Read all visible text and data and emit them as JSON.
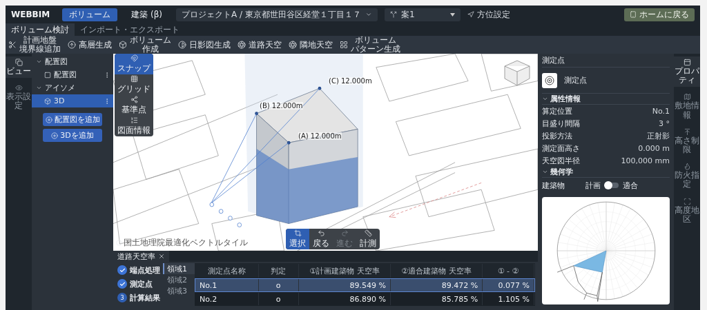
{
  "app": {
    "logo": "WEBBIM"
  },
  "mode_tabs": [
    {
      "label": "ボリューム",
      "selected": true
    },
    {
      "label": "建築 (β)",
      "selected": false
    }
  ],
  "project_select": {
    "value": "プロジェクトA / 東京都世田谷区経堂１丁目１７"
  },
  "plan_select": {
    "value": "案1"
  },
  "orientation_button": {
    "label": "方位設定"
  },
  "home_button": {
    "label": "ホームに戻る"
  },
  "sub_tabs": [
    {
      "label": "ボリューム検討",
      "selected": true
    },
    {
      "label": "インポート・エクスポート",
      "selected": false
    }
  ],
  "toolbar": [
    {
      "lines": [
        "計画地盤",
        "境界線追加"
      ]
    },
    {
      "lines": [
        "高層生成"
      ]
    },
    {
      "lines": [
        "ボリューム",
        "作成"
      ]
    },
    {
      "lines": [
        "日影図生成"
      ]
    },
    {
      "lines": [
        "道路天空"
      ]
    },
    {
      "lines": [
        "隣地天空"
      ]
    },
    {
      "lines": [
        "ボリューム",
        "パターン生成"
      ]
    }
  ],
  "left_rail": [
    {
      "label": "ビュー",
      "selected": true
    },
    {
      "label": "表示設定",
      "selected": false
    }
  ],
  "tree": [
    {
      "label": "配置図",
      "expanded": true,
      "children": [
        {
          "label": "配置図",
          "selected": false
        }
      ]
    },
    {
      "label": "アイソメ",
      "expanded": true,
      "children": [
        {
          "label": "3D",
          "selected": true
        }
      ]
    }
  ],
  "tree_buttons": [
    "配置図を追加",
    "3Dを追加"
  ],
  "canvas": {
    "side_tools": [
      {
        "label": "スナップ",
        "selected": true
      },
      {
        "label": "グリッド",
        "selected": false
      },
      {
        "label": "基準点",
        "selected": false
      },
      {
        "label": "図面情報",
        "selected": false
      }
    ],
    "bottom_tools": [
      {
        "label": "選択",
        "selected": true,
        "disabled": false
      },
      {
        "label": "戻る",
        "selected": false,
        "disabled": false
      },
      {
        "label": "進む",
        "selected": false,
        "disabled": true
      },
      {
        "label": "計測",
        "selected": false,
        "disabled": false
      }
    ],
    "height_labels": [
      "(C) 12.000m",
      "(B) 12.000m",
      "(A) 12.000m"
    ],
    "attribution": "国土地理院最適化ベクトルタイル"
  },
  "properties": {
    "title": "測定点",
    "object_name": "測定点",
    "sections": [
      {
        "title": "属性情報",
        "expanded": true,
        "rows": [
          {
            "kind": "value",
            "label": "算定位置",
            "value": "No.1"
          },
          {
            "kind": "value",
            "label": "目盛り間隔",
            "value": "3 °"
          },
          {
            "kind": "value",
            "label": "投影方法",
            "value": "正射影"
          },
          {
            "kind": "value",
            "label": "測定面高さ",
            "value": "0.000 m"
          },
          {
            "kind": "value",
            "label": "天空図半径",
            "value": "100,000 mm"
          }
        ]
      },
      {
        "title": "幾何学",
        "expanded": true,
        "rows": [
          {
            "kind": "toggle",
            "label": "建築物",
            "off_label": "計画",
            "on_label": "適合",
            "on": false
          }
        ]
      }
    ]
  },
  "right_rail": [
    {
      "label": "プロパティ",
      "selected": true
    },
    {
      "label": "敷地情報",
      "selected": false
    },
    {
      "label": "高さ制限",
      "selected": false
    },
    {
      "label": "防火指定",
      "selected": false
    },
    {
      "label": "高度地区",
      "selected": false
    }
  ],
  "bottom_panel": {
    "tab": "道路天空率",
    "steps": [
      {
        "label": "端点処理",
        "done": true
      },
      {
        "label": "測定点",
        "done": true
      },
      {
        "label": "計算結果",
        "done": false,
        "number": "3"
      }
    ],
    "regions": [
      {
        "label": "領域1",
        "selected": true
      },
      {
        "label": "領域2",
        "selected": false
      },
      {
        "label": "領域3",
        "selected": false
      }
    ],
    "table": {
      "columns": [
        "測定点名称",
        "判定",
        "①計画建築物 天空率",
        "②適合建築物 天空率",
        "① - ②"
      ],
      "rows": [
        {
          "selected": true,
          "cells": [
            "No.1",
            "o",
            "89.549 %",
            "89.472 %",
            "0.077 %"
          ]
        },
        {
          "selected": false,
          "cells": [
            "No.2",
            "o",
            "86.890 %",
            "85.785 %",
            "1.105 %"
          ]
        }
      ]
    }
  }
}
